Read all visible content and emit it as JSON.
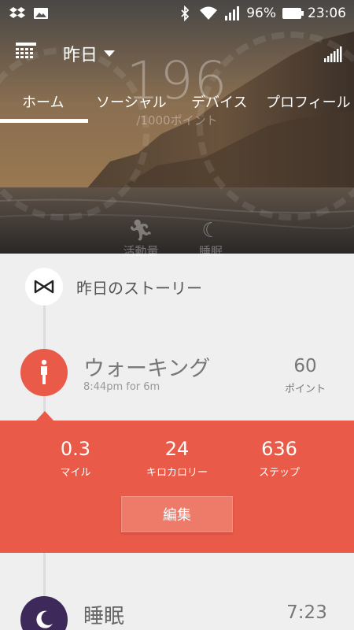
{
  "status_bar": {
    "battery_percent": "96%",
    "time": "23:06",
    "icons": [
      "dropbox-icon",
      "image-icon",
      "bluetooth-icon",
      "wifi-icon",
      "signal-icon",
      "battery-icon"
    ]
  },
  "header": {
    "date_label": "昨日",
    "points": "196",
    "points_goal": "/1000ポイント"
  },
  "tabs": [
    {
      "label": "ホーム",
      "active": true
    },
    {
      "label": "ソーシャル",
      "active": false
    },
    {
      "label": "デバイス",
      "active": false
    },
    {
      "label": "プロフィール",
      "active": false
    }
  ],
  "modes": [
    {
      "label": "活動量",
      "icon": "running-icon"
    },
    {
      "label": "睡眠",
      "icon": "moon-icon"
    }
  ],
  "story": {
    "title": "昨日のストーリー"
  },
  "walking": {
    "title": "ウォーキング",
    "subtitle": "8:44pm for 6m",
    "points_value": "60",
    "points_label": "ポイント",
    "stats": [
      {
        "value": "0.3",
        "label": "マイル"
      },
      {
        "value": "24",
        "label": "キロカロリー"
      },
      {
        "value": "636",
        "label": "ステップ"
      }
    ],
    "edit_label": "編集"
  },
  "sleep": {
    "title": "睡眠",
    "time": "7:23"
  },
  "colors": {
    "accent": "#ea5a48",
    "sleep": "#3d2a5a",
    "background": "#efefef"
  }
}
